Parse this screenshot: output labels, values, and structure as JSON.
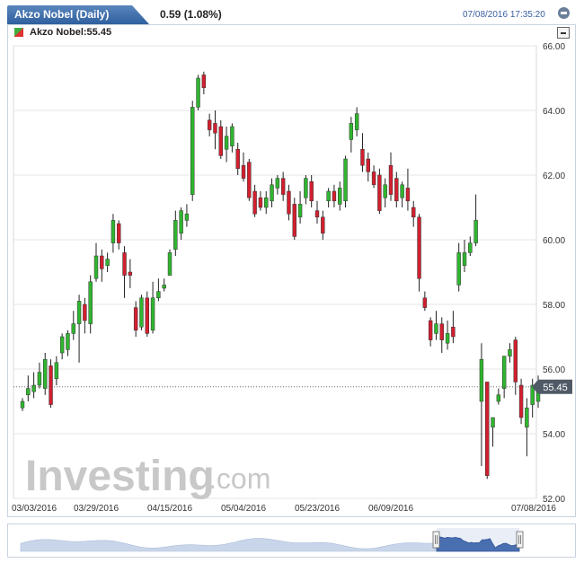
{
  "header": {
    "tab_title": "Akzo Nobel (Daily)",
    "change": "0.59 (1.08%)",
    "datetime": "07/08/2016 17:35:20"
  },
  "legend": {
    "label": "Akzo Nobel:55.45"
  },
  "watermark": {
    "main": "Investing",
    "suffix": ".com"
  },
  "colors": {
    "up": "#2fb52f",
    "down": "#d21f2f",
    "grid": "#e4e4e4",
    "axis_text": "#333333",
    "accent": "#3a5fa0"
  },
  "chart_data": {
    "type": "candlestick",
    "title": "Akzo Nobel (Daily)",
    "ylim": [
      52,
      66
    ],
    "yticks": [
      52,
      54,
      56,
      58,
      60,
      62,
      64,
      66
    ],
    "ytick_labels": [
      "52.00",
      "54.00",
      "56.00",
      "58.00",
      "60.00",
      "62.00",
      "64.00",
      "66.00"
    ],
    "xtick_labels": [
      "03/03/2016",
      "03/29/2016",
      "04/15/2016",
      "05/04/2016",
      "05/23/2016",
      "06/09/2016",
      "07/08/2016"
    ],
    "xtick_indices": [
      0,
      13,
      26,
      39,
      52,
      65,
      89
    ],
    "last_price": 55.45,
    "last_price_label": "55.45",
    "grid": true,
    "candles": [
      [
        54.8,
        55.0,
        54.7,
        55.1
      ],
      [
        55.2,
        55.4,
        55.0,
        55.8
      ],
      [
        55.3,
        55.5,
        55.1,
        55.9
      ],
      [
        55.5,
        55.9,
        55.4,
        56.2
      ],
      [
        55.4,
        56.3,
        55.2,
        56.5
      ],
      [
        56.1,
        54.9,
        54.8,
        56.3
      ],
      [
        55.7,
        56.2,
        55.5,
        56.4
      ],
      [
        56.5,
        57.0,
        56.3,
        57.1
      ],
      [
        56.6,
        57.1,
        56.4,
        57.2
      ],
      [
        57.1,
        57.4,
        56.9,
        57.8
      ],
      [
        57.4,
        58.1,
        56.2,
        58.3
      ],
      [
        58.0,
        57.5,
        57.1,
        58.2
      ],
      [
        57.4,
        58.7,
        57.1,
        58.9
      ],
      [
        58.8,
        59.5,
        58.7,
        59.9
      ],
      [
        59.5,
        59.1,
        58.7,
        59.7
      ],
      [
        59.2,
        59.4,
        59.0,
        59.6
      ],
      [
        59.9,
        60.6,
        59.6,
        60.8
      ],
      [
        60.5,
        59.9,
        59.7,
        60.6
      ],
      [
        59.6,
        58.9,
        58.2,
        59.8
      ],
      [
        59.0,
        58.9,
        58.5,
        59.4
      ],
      [
        57.9,
        57.2,
        57.0,
        58.1
      ],
      [
        57.3,
        58.2,
        57.2,
        58.3
      ],
      [
        58.2,
        57.1,
        57.0,
        58.4
      ],
      [
        57.2,
        58.2,
        57.1,
        58.7
      ],
      [
        58.2,
        58.4,
        58.1,
        58.8
      ],
      [
        58.5,
        58.6,
        58.4,
        58.8
      ],
      [
        58.9,
        59.6,
        58.9,
        59.7
      ],
      [
        59.7,
        60.6,
        59.5,
        60.9
      ],
      [
        60.2,
        60.9,
        60.0,
        61.0
      ],
      [
        60.6,
        60.8,
        60.4,
        61.1
      ],
      [
        61.4,
        64.1,
        61.2,
        64.3
      ],
      [
        64.1,
        65.0,
        64.0,
        65.1
      ],
      [
        65.1,
        64.7,
        64.5,
        65.2
      ],
      [
        63.7,
        63.4,
        63.2,
        63.9
      ],
      [
        63.6,
        63.3,
        62.8,
        64.0
      ],
      [
        63.5,
        62.6,
        62.5,
        63.7
      ],
      [
        62.8,
        63.2,
        62.4,
        63.5
      ],
      [
        62.9,
        63.5,
        62.7,
        63.6
      ],
      [
        62.8,
        62.2,
        62.0,
        63.0
      ],
      [
        62.3,
        61.9,
        61.8,
        62.7
      ],
      [
        62.4,
        61.3,
        61.2,
        62.5
      ],
      [
        61.5,
        60.8,
        60.7,
        61.7
      ],
      [
        61.3,
        61.0,
        60.9,
        61.5
      ],
      [
        61.0,
        61.3,
        60.8,
        61.5
      ],
      [
        61.2,
        61.7,
        61.0,
        61.9
      ],
      [
        61.6,
        61.9,
        61.4,
        62.0
      ],
      [
        61.9,
        61.4,
        61.2,
        62.1
      ],
      [
        61.5,
        60.8,
        60.6,
        61.7
      ],
      [
        61.1,
        60.1,
        60.0,
        61.3
      ],
      [
        60.7,
        61.1,
        60.5,
        61.5
      ],
      [
        61.3,
        61.9,
        61.1,
        62.0
      ],
      [
        61.8,
        61.2,
        61.0,
        62.0
      ],
      [
        60.9,
        60.7,
        60.5,
        61.2
      ],
      [
        60.7,
        60.2,
        60.0,
        60.9
      ],
      [
        61.2,
        61.5,
        61.0,
        61.6
      ],
      [
        61.5,
        61.2,
        61.0,
        61.7
      ],
      [
        61.1,
        61.6,
        60.9,
        61.8
      ],
      [
        61.2,
        62.5,
        61.0,
        62.6
      ],
      [
        63.1,
        63.6,
        62.7,
        63.8
      ],
      [
        63.4,
        63.9,
        63.2,
        64.1
      ],
      [
        62.8,
        62.3,
        62.1,
        63.3
      ],
      [
        62.5,
        62.1,
        61.8,
        62.7
      ],
      [
        62.1,
        61.7,
        61.6,
        62.3
      ],
      [
        62.0,
        60.9,
        60.8,
        62.2
      ],
      [
        61.3,
        61.7,
        61.0,
        61.9
      ],
      [
        62.3,
        61.4,
        61.2,
        62.7
      ],
      [
        61.9,
        61.2,
        61.0,
        62.1
      ],
      [
        61.3,
        61.7,
        61.0,
        61.8
      ],
      [
        61.6,
        61.2,
        60.9,
        62.2
      ],
      [
        61.0,
        60.7,
        60.4,
        61.2
      ],
      [
        60.7,
        58.8,
        58.4,
        60.8
      ],
      [
        58.2,
        57.9,
        57.8,
        58.4
      ],
      [
        57.5,
        56.9,
        56.7,
        57.6
      ],
      [
        57.1,
        57.4,
        56.9,
        57.8
      ],
      [
        57.4,
        56.9,
        56.5,
        57.6
      ],
      [
        56.8,
        57.1,
        56.6,
        57.5
      ],
      [
        57.3,
        57.0,
        56.8,
        57.8
      ],
      [
        58.6,
        59.6,
        58.4,
        59.9
      ],
      [
        59.2,
        59.6,
        59.0,
        60.0
      ],
      [
        59.6,
        59.9,
        59.5,
        60.1
      ],
      [
        59.9,
        60.6,
        59.8,
        61.4
      ],
      [
        55.0,
        56.3,
        53.0,
        56.8
      ],
      [
        55.6,
        52.7,
        52.6,
        55.6
      ],
      [
        54.2,
        54.5,
        53.6,
        54.5
      ],
      [
        55.0,
        55.2,
        54.9,
        55.4
      ],
      [
        55.4,
        56.4,
        55.1,
        56.4
      ],
      [
        56.4,
        56.6,
        56.2,
        56.8
      ],
      [
        56.9,
        55.6,
        55.2,
        57.0
      ],
      [
        55.5,
        54.5,
        54.3,
        55.7
      ],
      [
        54.2,
        54.8,
        53.3,
        55.1
      ],
      [
        54.9,
        55.5,
        54.5,
        55.7
      ],
      [
        55.0,
        55.5,
        54.8,
        55.8
      ]
    ]
  }
}
